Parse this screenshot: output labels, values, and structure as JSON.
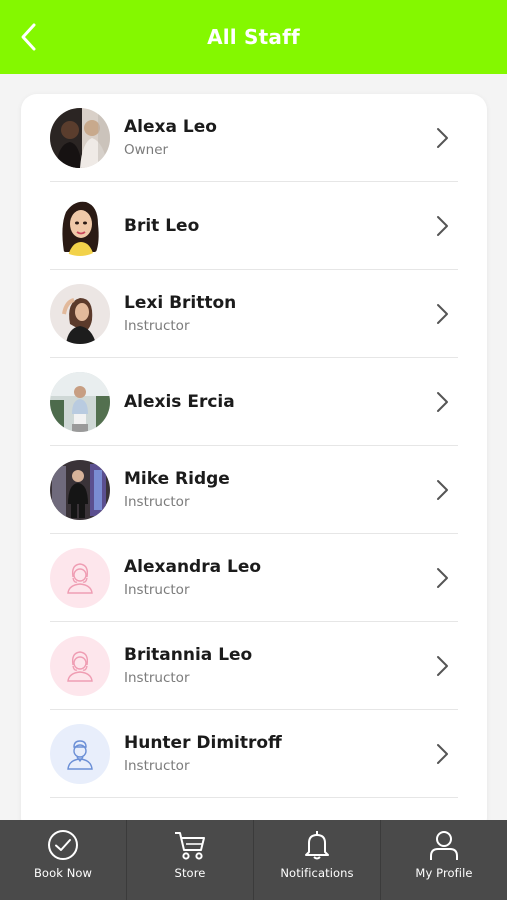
{
  "theme": {
    "header_bg": "#84f800",
    "tabbar_bg": "#4a4a4a",
    "pink_avatar_bg": "#fde6ec",
    "blue_avatar_bg": "#e8eefb"
  },
  "header": {
    "title": "All Staff",
    "back_icon": "chevron-left-icon"
  },
  "staff": [
    {
      "name": "Alexa Leo",
      "role": "Owner",
      "avatar": "photo"
    },
    {
      "name": "Brit Leo",
      "role": "",
      "avatar": "cartoon"
    },
    {
      "name": "Lexi Britton",
      "role": "Instructor",
      "avatar": "photo"
    },
    {
      "name": "Alexis Ercia",
      "role": "",
      "avatar": "photo"
    },
    {
      "name": "Mike Ridge",
      "role": "Instructor",
      "avatar": "photo"
    },
    {
      "name": "Alexandra Leo",
      "role": "Instructor",
      "avatar": "female-placeholder-icon"
    },
    {
      "name": "Britannia Leo",
      "role": "Instructor",
      "avatar": "female-placeholder-icon"
    },
    {
      "name": "Hunter Dimitroff",
      "role": "Instructor",
      "avatar": "male-placeholder-icon"
    }
  ],
  "tabs": [
    {
      "label": "Book Now",
      "icon": "check-circle-icon"
    },
    {
      "label": "Store",
      "icon": "cart-icon"
    },
    {
      "label": "Notifications",
      "icon": "bell-icon"
    },
    {
      "label": "My Profile",
      "icon": "user-icon"
    }
  ]
}
